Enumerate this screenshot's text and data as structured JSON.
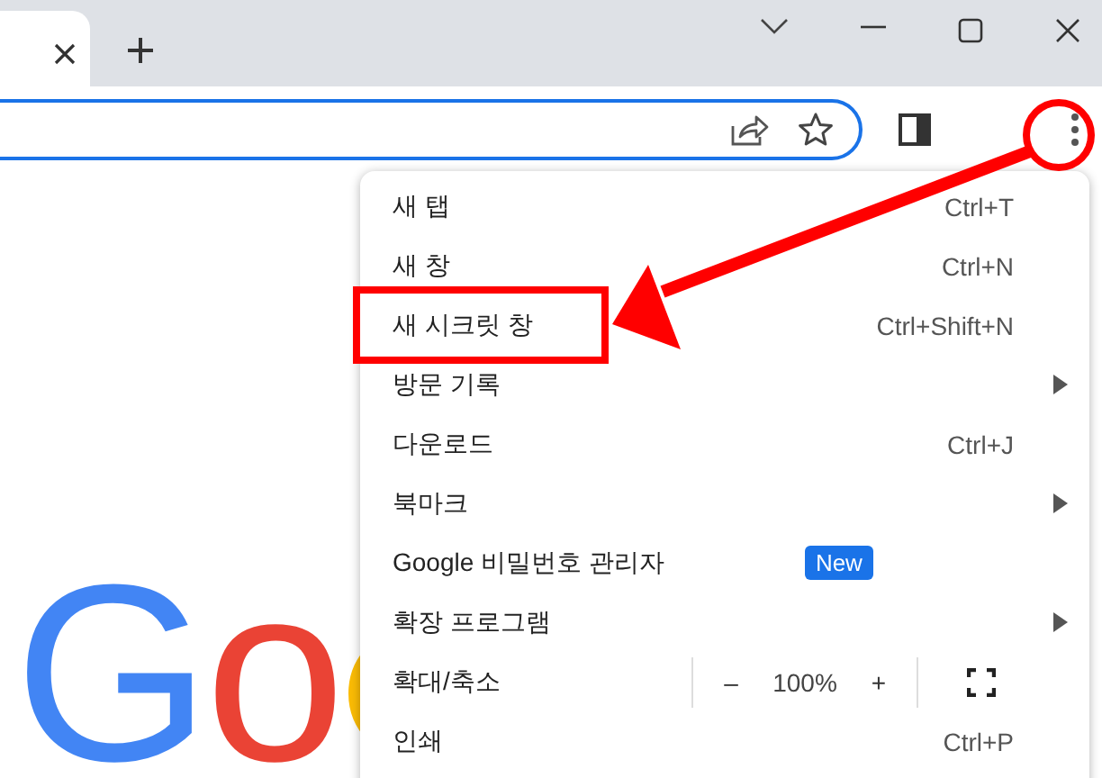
{
  "logo": {
    "text": "Go"
  },
  "menu": {
    "items": [
      {
        "kind": "item",
        "label": "새 탭",
        "shortcut": "Ctrl+T",
        "submenu": false
      },
      {
        "kind": "item",
        "label": "새 창",
        "shortcut": "Ctrl+N",
        "submenu": false
      },
      {
        "kind": "item",
        "label": "새 시크릿 창",
        "shortcut": "Ctrl+Shift+N",
        "submenu": false
      },
      {
        "kind": "item",
        "label": "방문 기록",
        "submenu": true
      },
      {
        "kind": "item",
        "label": "다운로드",
        "shortcut": "Ctrl+J",
        "submenu": false
      },
      {
        "kind": "item",
        "label": "북마크",
        "submenu": true
      },
      {
        "kind": "item",
        "label": "Google 비밀번호 관리자",
        "badge": "New",
        "submenu": false
      },
      {
        "kind": "item",
        "label": "확장 프로그램",
        "submenu": true
      },
      {
        "kind": "zoom",
        "label": "확대/축소",
        "minus": "–",
        "value": "100%",
        "plus": "+"
      },
      {
        "kind": "item",
        "label": "인쇄",
        "shortcut": "Ctrl+P",
        "submenu": false
      }
    ]
  }
}
